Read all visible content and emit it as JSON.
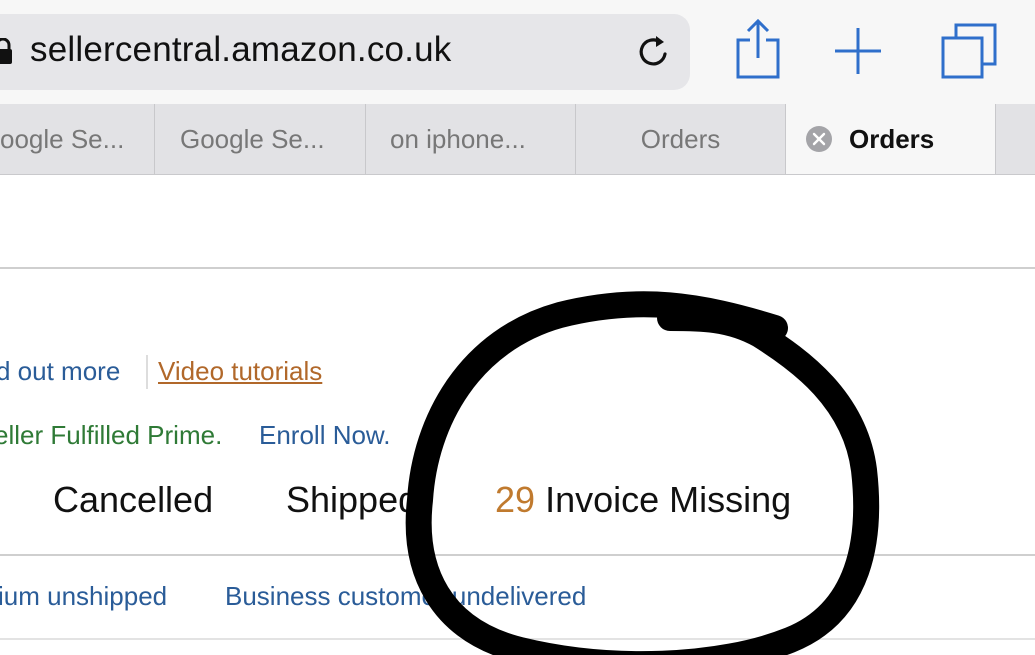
{
  "browser": {
    "url": "sellercentral.amazon.co.uk",
    "icons": {
      "lock": "lock-icon",
      "reload": "reload-icon",
      "share": "share-icon",
      "new_tab": "plus-icon",
      "tabs": "tabs-overview-icon",
      "close_tab": "close-icon"
    },
    "accent_color": "#2f6fcb",
    "tabs": [
      {
        "label": "oogle Se...",
        "active": false
      },
      {
        "label": "Google Se...",
        "active": false
      },
      {
        "label": "on iphone...",
        "active": false
      },
      {
        "label": "Orders",
        "active": false
      },
      {
        "label": "Orders",
        "active": true
      }
    ]
  },
  "page": {
    "links": {
      "find_out_more": "d out more",
      "video_tutorials": "Video tutorials"
    },
    "promo": {
      "text": "eller Fulfilled Prime.",
      "enroll": "Enroll Now."
    },
    "status_tabs": {
      "cancelled": "Cancelled",
      "shipped": "Shipped",
      "invoice_missing_count": "29",
      "invoice_missing_label": "Invoice Missing"
    },
    "filters": {
      "premium_unshipped": "ium unshipped",
      "business_undelivered": "Business customer undelivered"
    },
    "colors": {
      "link_blue": "#2a5c98",
      "link_orange": "#b1682a",
      "promo_green": "#2f7a36",
      "count_orange": "#c07a2e"
    }
  }
}
